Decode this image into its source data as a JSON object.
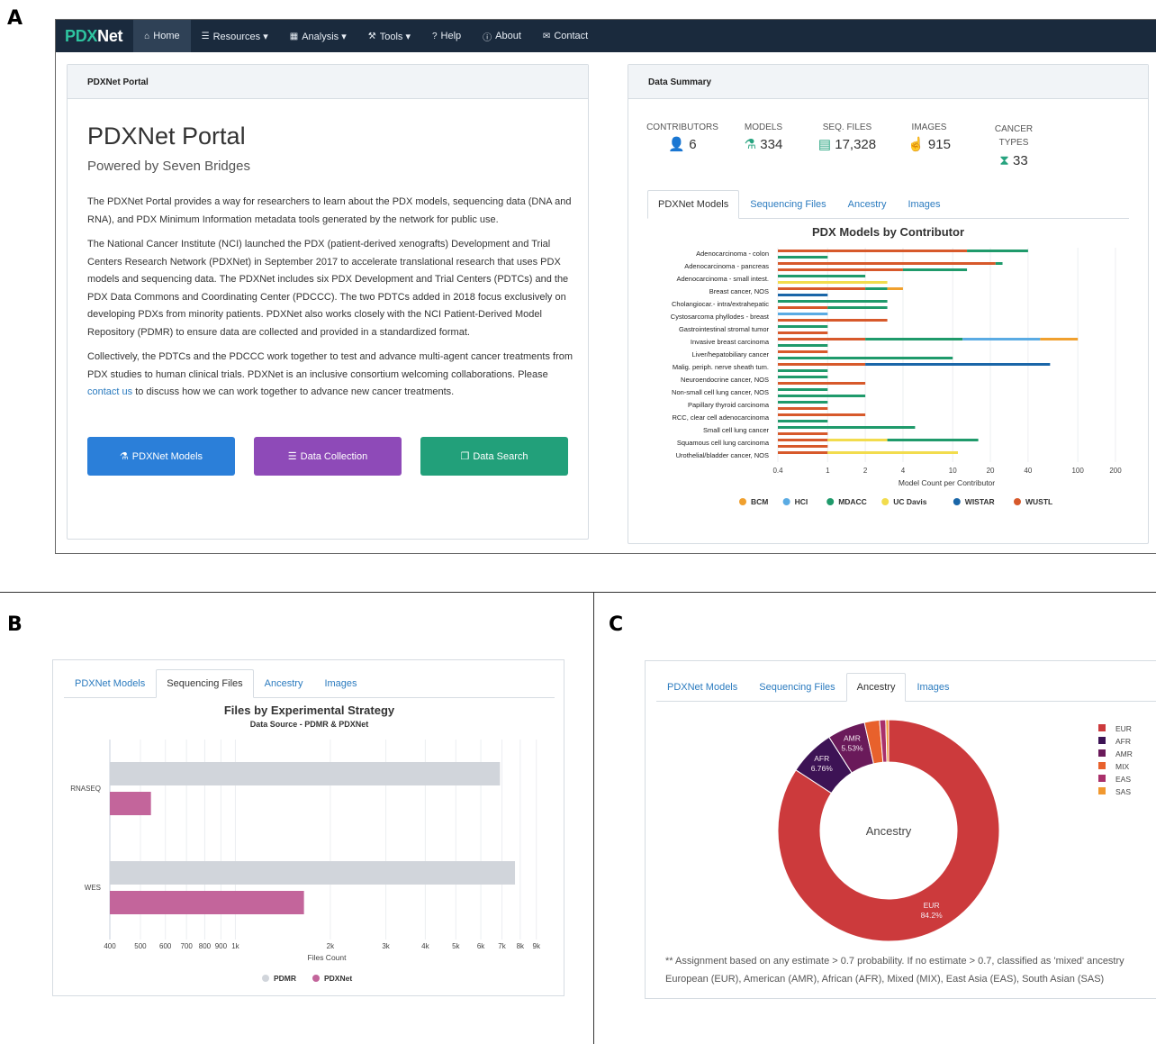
{
  "letters": {
    "a": "A",
    "b": "B",
    "c": "C"
  },
  "nav": {
    "brand_pdx": "PDX",
    "brand_net": "Net",
    "items": [
      {
        "label": "Home",
        "icon": "home-icon"
      },
      {
        "label": "Resources ▾",
        "icon": "list-icon"
      },
      {
        "label": "Analysis ▾",
        "icon": "chart-icon"
      },
      {
        "label": "Tools ▾",
        "icon": "tools-icon"
      },
      {
        "label": "Help",
        "icon": "help-icon"
      },
      {
        "label": "About",
        "icon": "info-icon"
      },
      {
        "label": "Contact",
        "icon": "mail-icon"
      }
    ]
  },
  "portal": {
    "card_header": "PDXNet Portal",
    "title": "PDXNet Portal",
    "subtitle": "Powered by Seven Bridges",
    "p1": "The PDXNet Portal provides a way for researchers to learn about the PDX models, sequencing data (DNA and RNA), and PDX Minimum Information metadata tools generated by the network for public use.",
    "p2": "The National Cancer Institute (NCI) launched the PDX (patient-derived xenografts) Development and Trial Centers Research Network (PDXNet) in September 2017 to accelerate translational research that uses PDX models and sequencing data. The PDXNet includes six PDX Development and Trial Centers (PDTCs) and the PDX Data Commons and Coordinating Center (PDCCC). The two PDTCs added in 2018 focus exclusively on developing PDXs from minority patients. PDXNet also works closely with the NCI Patient-Derived Model Repository (PDMR) to ensure data are collected and provided in a standardized format.",
    "p3_before": "Collectively, the PDTCs and the PDCCC work together to test and advance multi-agent cancer treatments from PDX studies to human clinical trials. PDXNet is an inclusive consortium welcoming collaborations. Please ",
    "p3_link": "contact us",
    "p3_after": " to discuss how we can work together to advance new cancer treatments.",
    "buttons": [
      {
        "label": "PDXNet Models",
        "color": "#2b7fd9",
        "icon": "flask-icon"
      },
      {
        "label": "Data Collection",
        "color": "#8e4ab8",
        "icon": "database-icon"
      },
      {
        "label": "Data Search",
        "color": "#22a07a",
        "icon": "search-files-icon"
      }
    ]
  },
  "summary": {
    "card_header": "Data Summary",
    "stats": [
      {
        "label": "CONTRIBUTORS",
        "value": "6",
        "icon": "person-icon"
      },
      {
        "label": "MODELS",
        "value": "334",
        "icon": "flask-icon"
      },
      {
        "label": "SEQ. FILES",
        "value": "17,328",
        "icon": "file-icon"
      },
      {
        "label": "IMAGES",
        "value": "915",
        "icon": "hand-icon"
      },
      {
        "label": "CANCER TYPES",
        "value": "33",
        "icon": "hourglass-icon"
      }
    ],
    "tabs": [
      "PDXNet Models",
      "Sequencing Files",
      "Ancestry",
      "Images"
    ]
  },
  "colors": {
    "BCM": "#f0a02e",
    "HCI": "#5aabe3",
    "MDACC": "#1f9a6b",
    "UC Davis": "#f2dc4d",
    "WISTAR": "#1a66a8",
    "WUSTL": "#d7592b",
    "PDMR": "#d1d5db",
    "PDXNet": "#c3659b"
  },
  "chart_data": [
    {
      "type": "bar",
      "orientation": "horizontal",
      "title": "PDX Models by Contributor",
      "xlabel": "Model Count per Contributor",
      "xscale": "log",
      "xlim": [
        0.4,
        200
      ],
      "xticks": [
        "0.4",
        "1",
        "2",
        "4",
        "10",
        "20",
        "40",
        "100",
        "200"
      ],
      "legend": [
        "BCM",
        "HCI",
        "MDACC",
        "UC Davis",
        "WISTAR",
        "WUSTL"
      ],
      "legend_position": "bottom",
      "categories": [
        {
          "label": "Adenocarcinoma - colon",
          "bars": [
            {
              "s": "WUSTL",
              "segs": [
                [
                  "WUSTL",
                  13
                ],
                [
                  "MDACC",
                  40
                ]
              ]
            },
            {
              "s": "MDACC",
              "segs": [
                [
                  "MDACC",
                  1
                ]
              ]
            }
          ]
        },
        {
          "label": "Adenocarcinoma - pancreas",
          "bars": [
            {
              "s": "WUSTL",
              "segs": [
                [
                  "WUSTL",
                  22
                ],
                [
                  "MDACC",
                  25
                ]
              ]
            },
            {
              "s": "WUSTL",
              "segs": [
                [
                  "WUSTL",
                  4
                ],
                [
                  "MDACC",
                  13
                ]
              ]
            }
          ]
        },
        {
          "label": "Adenocarcinoma - small intest.",
          "bars": [
            {
              "s": "MDACC",
              "segs": [
                [
                  "MDACC",
                  2
                ]
              ]
            },
            {
              "s": "UC Davis",
              "segs": [
                [
                  "UC Davis",
                  3
                ]
              ]
            }
          ]
        },
        {
          "label": "Breast cancer, NOS",
          "bars": [
            {
              "s": "WUSTL",
              "segs": [
                [
                  "WUSTL",
                  2
                ],
                [
                  "MDACC",
                  3
                ],
                [
                  "BCM",
                  4
                ]
              ]
            },
            {
              "s": "WISTAR",
              "segs": [
                [
                  "WISTAR",
                  1
                ]
              ]
            }
          ]
        },
        {
          "label": "Cholangiocar.- intra/extrahepatic",
          "bars": [
            {
              "s": "MDACC",
              "segs": [
                [
                  "MDACC",
                  3
                ]
              ]
            },
            {
              "s": "WUSTL",
              "segs": [
                [
                  "WUSTL",
                  1
                ],
                [
                  "MDACC",
                  3
                ]
              ]
            }
          ]
        },
        {
          "label": "Cystosarcoma phyllodes - breast",
          "bars": [
            {
              "s": "HCI",
              "segs": [
                [
                  "HCI",
                  1
                ]
              ]
            },
            {
              "s": "WUSTL",
              "segs": [
                [
                  "WUSTL",
                  3
                ]
              ]
            }
          ]
        },
        {
          "label": "Gastrointestinal stromal tumor",
          "bars": [
            {
              "s": "MDACC",
              "segs": [
                [
                  "MDACC",
                  1
                ]
              ]
            },
            {
              "s": "WUSTL",
              "segs": [
                [
                  "WUSTL",
                  1
                ]
              ]
            }
          ]
        },
        {
          "label": "Invasive breast carcinoma",
          "bars": [
            {
              "s": "WUSTL",
              "segs": [
                [
                  "WUSTL",
                  2
                ],
                [
                  "MDACC",
                  12
                ],
                [
                  "HCI",
                  50
                ],
                [
                  "BCM",
                  100
                ]
              ]
            },
            {
              "s": "MDACC",
              "segs": [
                [
                  "MDACC",
                  1
                ]
              ]
            }
          ]
        },
        {
          "label": "Liver/hepatobiliary cancer",
          "bars": [
            {
              "s": "WUSTL",
              "segs": [
                [
                  "WUSTL",
                  1
                ]
              ]
            },
            {
              "s": "MDACC",
              "segs": [
                [
                  "MDACC",
                  10
                ]
              ]
            }
          ]
        },
        {
          "label": "Malig. periph. nerve sheath tum.",
          "bars": [
            {
              "s": "WUSTL",
              "segs": [
                [
                  "WUSTL",
                  2
                ],
                [
                  "WISTAR",
                  60
                ]
              ]
            },
            {
              "s": "MDACC",
              "segs": [
                [
                  "MDACC",
                  1
                ]
              ]
            }
          ]
        },
        {
          "label": "Neuroendocrine cancer, NOS",
          "bars": [
            {
              "s": "MDACC",
              "segs": [
                [
                  "MDACC",
                  1
                ]
              ]
            },
            {
              "s": "WUSTL",
              "segs": [
                [
                  "WUSTL",
                  2
                ]
              ]
            }
          ]
        },
        {
          "label": "Non-small cell lung cancer, NOS",
          "bars": [
            {
              "s": "MDACC",
              "segs": [
                [
                  "MDACC",
                  1
                ]
              ]
            },
            {
              "s": "MDACC",
              "segs": [
                [
                  "MDACC",
                  2
                ]
              ]
            }
          ]
        },
        {
          "label": "Papillary thyroid carcinoma",
          "bars": [
            {
              "s": "MDACC",
              "segs": [
                [
                  "MDACC",
                  1
                ]
              ]
            },
            {
              "s": "WUSTL",
              "segs": [
                [
                  "WUSTL",
                  1
                ]
              ]
            }
          ]
        },
        {
          "label": "RCC, clear cell adenocarcinoma",
          "bars": [
            {
              "s": "WUSTL",
              "segs": [
                [
                  "WUSTL",
                  2
                ]
              ]
            },
            {
              "s": "MDACC",
              "segs": [
                [
                  "MDACC",
                  1
                ]
              ]
            }
          ]
        },
        {
          "label": "Small cell lung cancer",
          "bars": [
            {
              "s": "MDACC",
              "segs": [
                [
                  "MDACC",
                  5
                ]
              ]
            },
            {
              "s": "WUSTL",
              "segs": [
                [
                  "WUSTL",
                  1
                ]
              ]
            }
          ]
        },
        {
          "label": "Squamous cell lung carcinoma",
          "bars": [
            {
              "s": "WUSTL",
              "segs": [
                [
                  "WUSTL",
                  1
                ],
                [
                  "UC Davis",
                  3
                ],
                [
                  "MDACC",
                  16
                ]
              ]
            },
            {
              "s": "WUSTL",
              "segs": [
                [
                  "WUSTL",
                  1
                ]
              ]
            }
          ]
        },
        {
          "label": "Urothelial/bladder cancer, NOS",
          "bars": [
            {
              "s": "WUSTL",
              "segs": [
                [
                  "WUSTL",
                  1
                ],
                [
                  "UC Davis",
                  11
                ]
              ]
            }
          ]
        }
      ]
    },
    {
      "type": "bar",
      "orientation": "horizontal",
      "title": "Files by Experimental Strategy",
      "subtitle": "Data Source - PDMR & PDXNet",
      "xlabel": "Files Count",
      "xscale": "log",
      "xlim": [
        400,
        9500
      ],
      "xticks": [
        "400",
        "500",
        "600",
        "700",
        "800",
        "900",
        "1k",
        "2k",
        "3k",
        "4k",
        "5k",
        "6k",
        "7k",
        "8k",
        "9k"
      ],
      "categories": [
        "RNASEQ",
        "WES"
      ],
      "series": [
        {
          "name": "PDMR",
          "values": [
            6900,
            7700
          ]
        },
        {
          "name": "PDXNet",
          "values": [
            540,
            1650
          ]
        }
      ],
      "legend_position": "bottom"
    },
    {
      "type": "pie",
      "style": "donut",
      "center_label": "Ancestry",
      "slices": [
        {
          "name": "EUR",
          "label": "EUR\n84.2%",
          "value": 84.2,
          "color": "#cc3a3c"
        },
        {
          "name": "AFR",
          "label": "AFR\n6.76%",
          "value": 6.76,
          "color": "#3d1355"
        },
        {
          "name": "AMR",
          "label": "AMR\n5.53%",
          "value": 5.53,
          "color": "#6a1a5a"
        },
        {
          "name": "MIX",
          "value": 2.2,
          "color": "#e8612c"
        },
        {
          "name": "EAS",
          "value": 0.9,
          "color": "#a9306b"
        },
        {
          "name": "SAS",
          "value": 0.41,
          "color": "#f1982f"
        }
      ],
      "legend_position": "right"
    }
  ],
  "b": {
    "tabs": [
      "PDXNet Models",
      "Sequencing Files",
      "Ancestry",
      "Images"
    ],
    "title": "Files by Experimental Strategy",
    "subtitle": "Data Source - PDMR & PDXNet",
    "xlabel": "Files Count"
  },
  "c": {
    "tabs": [
      "PDXNet Models",
      "Sequencing Files",
      "Ancestry",
      "Images"
    ],
    "note1": "** Assignment based on any estimate > 0.7 probability. If no estimate > 0.7, classified as 'mixed' ancestry",
    "note2": "European (EUR), American (AMR), African (AFR), Mixed (MIX), East Asia (EAS), South Asian (SAS)"
  }
}
